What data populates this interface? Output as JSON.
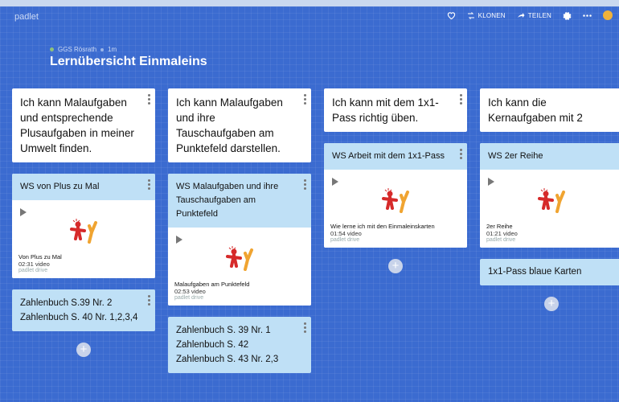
{
  "brand": "padlet",
  "toolbar": {
    "clone": "KLONEN",
    "share": "TEILEN"
  },
  "meta": {
    "author": "GGS Rösrath",
    "time": "1m"
  },
  "board_title": "Lernübersicht Einmaleins",
  "columns": [
    {
      "title": "Ich kann Malaufgaben und entsprechende Plusaufgaben in meiner Umwelt finden.",
      "posts": [
        {
          "title": "WS von Plus zu Mal",
          "video": {
            "title": "Von Plus zu Mal",
            "duration": "02:31 video",
            "source": "padlet drive"
          }
        },
        {
          "text": "Zahlenbuch S.39 Nr. 2\nZahlenbuch S. 40 Nr. 1,2,3,4"
        }
      ]
    },
    {
      "title": "Ich kann Malaufgaben und ihre Tauschaufgaben am Punktefeld darstellen.",
      "posts": [
        {
          "title": "WS Malaufgaben und ihre Tauschaufgaben am Punktefeld",
          "video": {
            "title": "Malaufgaben am Punktefeld",
            "duration": "02:53 video",
            "source": "padlet drive"
          }
        },
        {
          "text": "Zahlenbuch S. 39 Nr. 1\nZahlenbuch S. 42\nZahlenbuch S. 43 Nr. 2,3"
        }
      ]
    },
    {
      "title": "Ich kann mit dem 1x1-Pass richtig üben.",
      "posts": [
        {
          "title": "WS Arbeit mit dem 1x1-Pass",
          "video": {
            "title": "Wie lerne ich mit den Einmaleinskarten",
            "duration": "01:54 video",
            "source": "padlet drive"
          }
        }
      ]
    },
    {
      "title": "Ich kann die Kernaufgaben mit 2",
      "posts": [
        {
          "title": "WS 2er Reihe",
          "video": {
            "title": "2er Reihe",
            "duration": "01:21 video",
            "source": "padlet drive"
          }
        },
        {
          "title": "1x1-Pass blaue Karten"
        }
      ]
    }
  ],
  "add_label": "+"
}
